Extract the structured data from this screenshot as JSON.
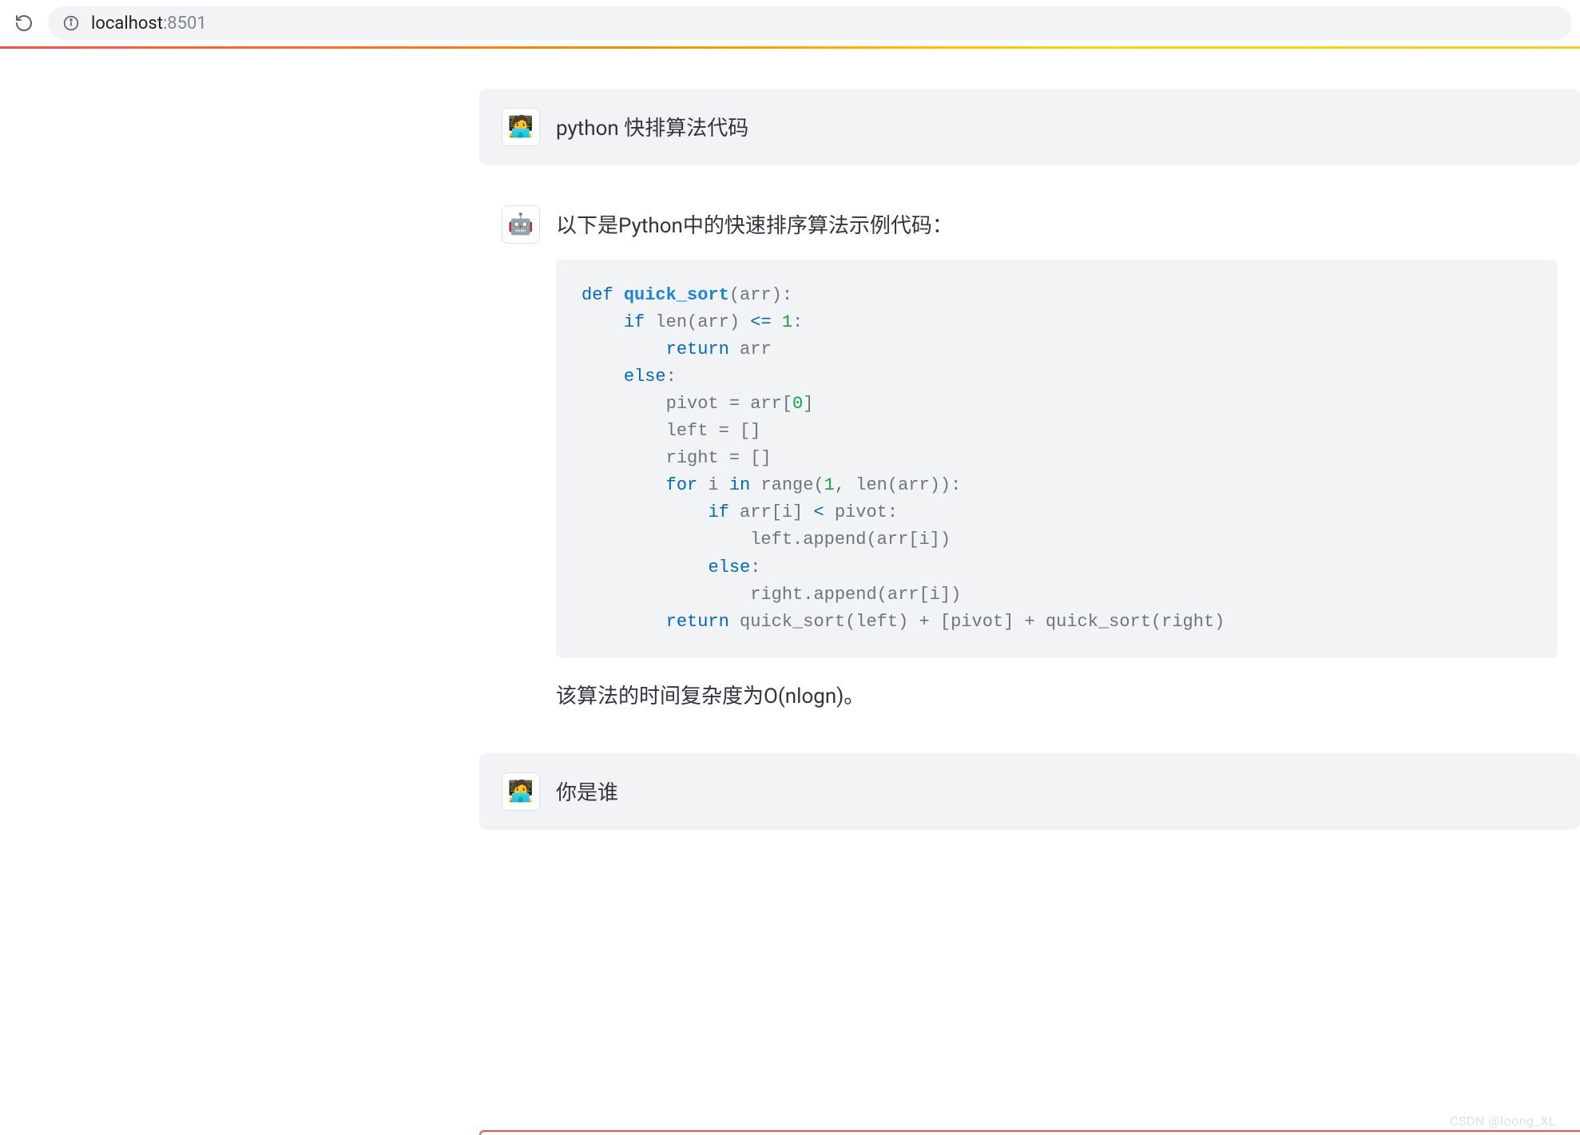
{
  "browser": {
    "url_host": "localhost",
    "url_port": ":8501"
  },
  "messages": [
    {
      "role": "user",
      "avatar": "🧑‍💻",
      "text": "python 快排算法代码"
    },
    {
      "role": "assistant",
      "avatar": "🤖",
      "intro": "以下是Python中的快速排序算法示例代码：",
      "code": {
        "language": "python",
        "tokens": [
          [
            [
              "def",
              "kw"
            ],
            [
              " ",
              "plain"
            ],
            [
              "quick_sort",
              "fn"
            ],
            [
              "(arr):",
              "plain"
            ]
          ],
          [
            [
              "    ",
              "plain"
            ],
            [
              "if",
              "kw"
            ],
            [
              " len(arr) ",
              "plain"
            ],
            [
              "<=",
              "op"
            ],
            [
              " ",
              "plain"
            ],
            [
              "1",
              "num"
            ],
            [
              ":",
              "plain"
            ]
          ],
          [
            [
              "        ",
              "plain"
            ],
            [
              "return",
              "kw"
            ],
            [
              " arr",
              "plain"
            ]
          ],
          [
            [
              "    ",
              "plain"
            ],
            [
              "else",
              "kw"
            ],
            [
              ":",
              "plain"
            ]
          ],
          [
            [
              "        pivot = arr[",
              "plain"
            ],
            [
              "0",
              "num"
            ],
            [
              "]",
              "plain"
            ]
          ],
          [
            [
              "        left = []",
              "plain"
            ]
          ],
          [
            [
              "        right = []",
              "plain"
            ]
          ],
          [
            [
              "        ",
              "plain"
            ],
            [
              "for",
              "kw"
            ],
            [
              " i ",
              "plain"
            ],
            [
              "in",
              "kw"
            ],
            [
              " range(",
              "plain"
            ],
            [
              "1",
              "num"
            ],
            [
              ", len(arr)):",
              "plain"
            ]
          ],
          [
            [
              "            ",
              "plain"
            ],
            [
              "if",
              "kw"
            ],
            [
              " arr[i] ",
              "plain"
            ],
            [
              "<",
              "op"
            ],
            [
              " pivot:",
              "plain"
            ]
          ],
          [
            [
              "                left.append(arr[i])",
              "plain"
            ]
          ],
          [
            [
              "            ",
              "plain"
            ],
            [
              "else",
              "kw"
            ],
            [
              ":",
              "plain"
            ]
          ],
          [
            [
              "                right.append(arr[i])",
              "plain"
            ]
          ],
          [
            [
              "        ",
              "plain"
            ],
            [
              "return",
              "kw"
            ],
            [
              " quick_sort(left) + [pivot] + quick_sort(right)",
              "plain"
            ]
          ]
        ]
      },
      "outro": "该算法的时间复杂度为O(nlogn)。"
    },
    {
      "role": "user",
      "avatar": "🧑‍💻",
      "text": "你是谁"
    }
  ],
  "watermark": "CSDN @loong_XL"
}
